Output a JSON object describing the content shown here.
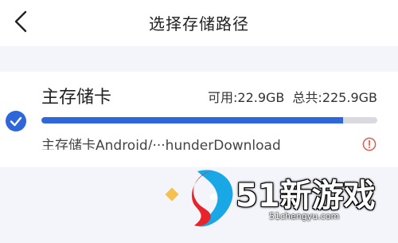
{
  "header": {
    "title": "选择存储路径",
    "back_icon": "chevron-left-icon"
  },
  "storage": {
    "selected": true,
    "name": "主存储卡",
    "available_label": "可用:22.9GB",
    "total_label": "总共:225.9GB",
    "used_fraction": 0.899,
    "path": "主存储卡Android/···hunderDownload",
    "warning_icon": "warning-circle-icon"
  },
  "watermark": {
    "text": "51新游戏",
    "url": "51chengyu.com"
  },
  "colors": {
    "accent": "#2f66d9",
    "track": "#d9d9df",
    "warning": "#e05a4b",
    "background": "#f3f5fa"
  }
}
